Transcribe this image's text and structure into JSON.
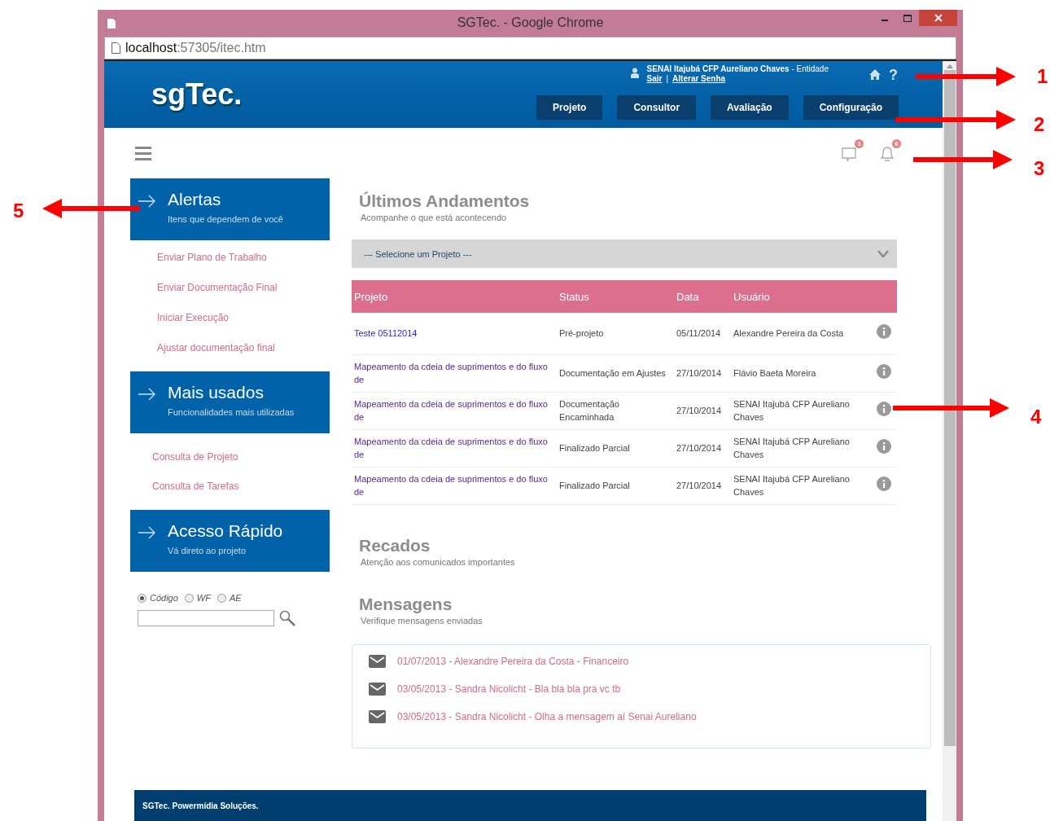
{
  "window": {
    "title": "SGTec. - Google Chrome",
    "url_host": "localhost",
    "url_path": ":57305/itec.htm"
  },
  "header": {
    "logo": "sgTec.",
    "user_name": "SENAI Itajubá CFP Aureliano Chaves",
    "user_role": " - Entidade",
    "links": [
      "Sair",
      "Alterar Senha"
    ],
    "separator": "|",
    "help": "?",
    "nav": [
      {
        "label": "Projeto"
      },
      {
        "label": "Consultor"
      },
      {
        "label": "Avaliação"
      },
      {
        "label": "Configuração"
      }
    ]
  },
  "toolbar": {
    "messages_count": "3",
    "notifications_count": "6"
  },
  "sidebar": [
    {
      "kind": "links",
      "title": "Alertas",
      "subtitle": "Itens que dependem de você",
      "items": [
        "Enviar Plano de Trabalho",
        "Enviar Documentação Final",
        "Iniciar Execução",
        "Ajustar documentação final"
      ]
    },
    {
      "kind": "links",
      "title": "Mais usados",
      "subtitle": "Funcionalidades mais utilizadas",
      "items": [
        "Consulta de Projeto",
        "Consulta de Tarefas"
      ]
    },
    {
      "kind": "search",
      "title": "Acesso Rápido",
      "subtitle": "Vá direto ao projeto",
      "radios": [
        {
          "label": "Código",
          "selected": true
        },
        {
          "label": "WF",
          "selected": false
        },
        {
          "label": "AE",
          "selected": false
        }
      ]
    }
  ],
  "progress": {
    "title": "Últimos Andamentos",
    "subtitle": "Acompanhe o que está acontecendo",
    "select": "--- Selecione um Projeto ---",
    "columns": [
      "Projeto",
      "Status",
      "Data",
      "Usuário"
    ],
    "rows": [
      {
        "project": "Teste 05112014",
        "visited": false,
        "status": "Pré-projeto",
        "date": "05/11/2014",
        "user": "Alexandre Pereira da Costa"
      },
      {
        "project": "Mapeamento da cdeia de suprimentos e do fluxo de",
        "visited": true,
        "status": "Documentação em Ajustes",
        "date": "27/10/2014",
        "user": "Flávio Baeta Moreira"
      },
      {
        "project": "Mapeamento da cdeia de suprimentos e do fluxo de",
        "visited": true,
        "status": "Documentação Encaminhada",
        "date": "27/10/2014",
        "user": "SENAI Itajubá CFP Aureliano Chaves"
      },
      {
        "project": "Mapeamento da cdeia de suprimentos e do fluxo de",
        "visited": true,
        "status": "Finalizado Parcial",
        "date": "27/10/2014",
        "user": "SENAI Itajubá CFP Aureliano Chaves"
      },
      {
        "project": "Mapeamento da cdeia de suprimentos e do fluxo de",
        "visited": true,
        "status": "Finalizado Parcial",
        "date": "27/10/2014",
        "user": "SENAI Itajubá CFP Aureliano Chaves"
      }
    ]
  },
  "notices": {
    "title": "Recados",
    "subtitle": "Atenção aos comunicados importantes"
  },
  "messages": {
    "title": "Mensagens",
    "subtitle": "Verifique mensagens enviadas",
    "items": [
      "01/07/2013 - Alexandre Pereira da Costa - Financeiro",
      "03/05/2013 - Sandra Nicolicht - Bla bla bla pra vc tb",
      "03/05/2013 - Sandra Nicolicht - Olha a mensagem aí Senai Aureliano"
    ]
  },
  "footer": "SGTec. Powermídia Soluções.",
  "annotations": [
    {
      "label": "1"
    },
    {
      "label": "2"
    },
    {
      "label": "3"
    },
    {
      "label": "4"
    },
    {
      "label": "5"
    }
  ]
}
